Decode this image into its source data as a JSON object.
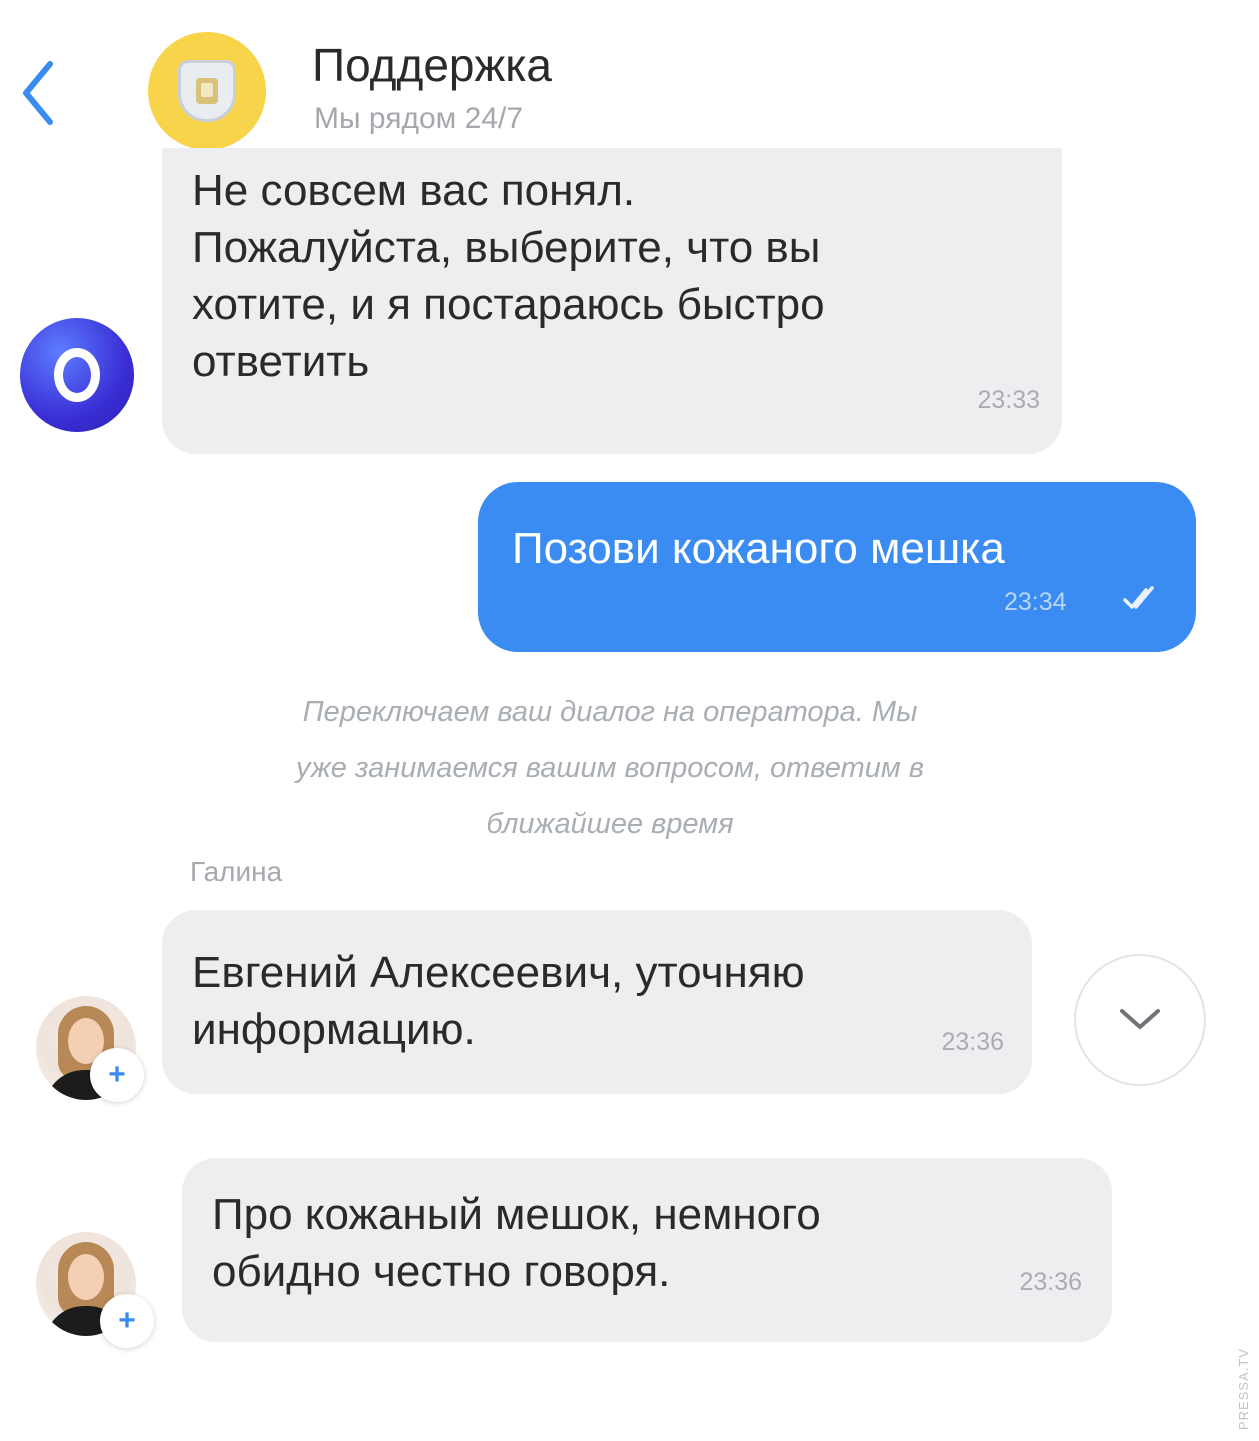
{
  "header": {
    "title": "Поддержка",
    "subtitle": "Мы рядом 24/7",
    "back_icon": "chevron-left-icon",
    "avatar_icon": "bank-crest-icon"
  },
  "messages": [
    {
      "sender": "bot",
      "text": "Не совсем вас понял.\nПожалуйста, выберите, что вы\nхотите, и я постараюсь быстро\nответить",
      "time": "23:33"
    },
    {
      "sender": "user",
      "text": "Позови кожаного мешка",
      "time": "23:34",
      "status_icon": "double-check-icon"
    }
  ],
  "system_note": "Переключаем ваш диалог на оператора. Мы\nуже занимаемся вашим вопросом, ответим в\nближайшее время",
  "operator": {
    "name": "Галина",
    "messages": [
      {
        "text": "Евгений Алексеевич, уточняю\nинформацию.",
        "time": "23:36"
      },
      {
        "text": "Про кожаный мешок, немного\nобидно честно говоря.",
        "time": "23:36"
      }
    ],
    "add_label": "+"
  },
  "scroll_button_icon": "chevron-down-icon",
  "watermark": "PRESSA.TV",
  "colors": {
    "user_bubble": "#3a8cf2",
    "incoming_bubble": "#eeeef0",
    "header_avatar": "#f7d44a",
    "bot_avatar": "#3a2fd6",
    "accent": "#3a8cf2"
  }
}
